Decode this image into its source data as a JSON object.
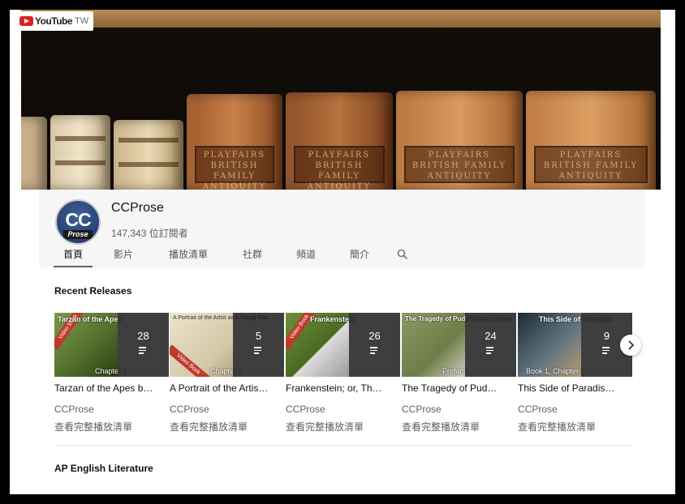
{
  "logo": {
    "word": "YouTube",
    "region": "TW"
  },
  "channel": {
    "avatar_text": "CC",
    "avatar_sub": "Prose",
    "name": "CCProse",
    "subscribers": "147,343 位訂閱者"
  },
  "tabs": [
    {
      "label": "首頁",
      "active": true
    },
    {
      "label": "影片"
    },
    {
      "label": "播放清單"
    },
    {
      "label": "社群"
    },
    {
      "label": "頻道"
    },
    {
      "label": "簡介"
    }
  ],
  "banner_labels": [
    "PLAYFAIRS BRITISH FAMILY ANTIQUITY"
  ],
  "section1": {
    "title": "Recent Releases",
    "playlists": [
      {
        "thumb_title": "Tarzan of the Apes",
        "caption": "Chapter 1",
        "count": "28",
        "title": "Tarzan of the Apes b…",
        "channel": "CCProse",
        "link": "查看完整播放清單",
        "color": "#5f7a3a"
      },
      {
        "thumb_title": "A Portrait of the Artist as a Young Man",
        "caption": "Chapter 1",
        "count": "5",
        "title": "A Portrait of the Artis…",
        "channel": "CCProse",
        "link": "查看完整播放清單",
        "color": "#d9cfb4"
      },
      {
        "thumb_title": "Frankenstein",
        "caption": "",
        "count": "26",
        "title": "Frankenstein; or, The …",
        "channel": "CCProse",
        "link": "查看完整播放清單",
        "color": "#5a7a2c"
      },
      {
        "thumb_title": "The Tragedy of Pudd'nhead Wilson",
        "caption": "Preface",
        "count": "24",
        "title": "The Tragedy of Pudd'…",
        "channel": "CCProse",
        "link": "查看完整播放清單",
        "color": "#7c8a56"
      },
      {
        "thumb_title": "This Side of Paradise",
        "caption": "Book 1, Chapter 1",
        "count": "9",
        "title": "This Side of Paradise…",
        "channel": "CCProse",
        "link": "查看完整播放清單",
        "color": "#4a5a64"
      }
    ]
  },
  "section2": {
    "title": "AP English Literature"
  },
  "colors": {
    "accent": "#e02020",
    "text": "#111111",
    "muted": "#606060"
  }
}
